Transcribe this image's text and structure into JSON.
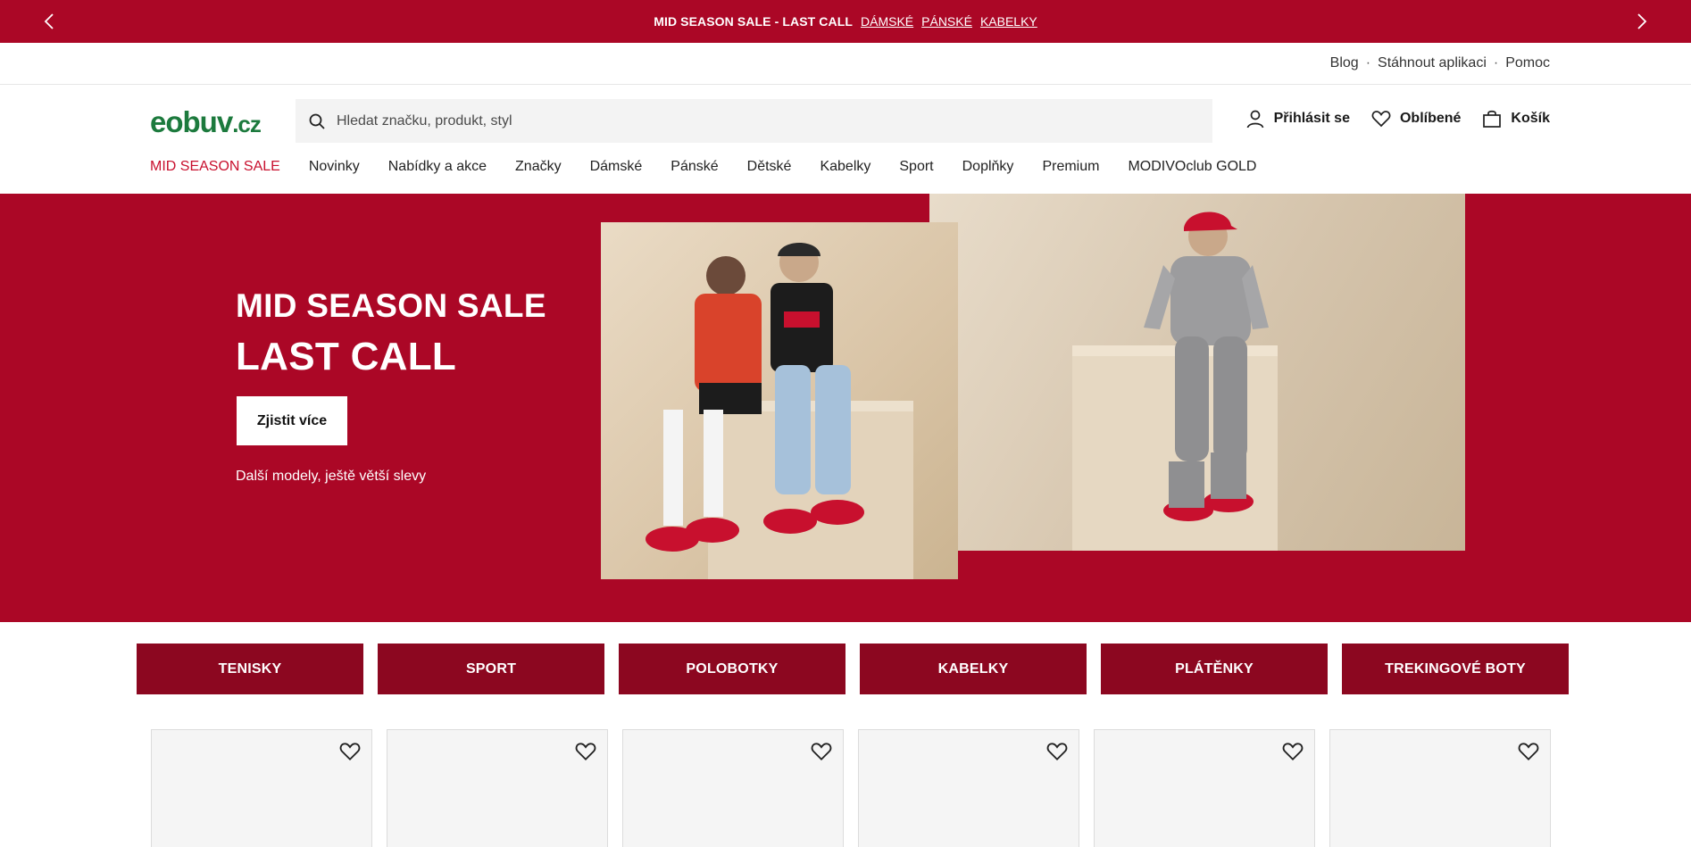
{
  "promo": {
    "text": "MID SEASON SALE - LAST CALL",
    "links": [
      "DÁMSKÉ",
      "PÁNSKÉ",
      "KABELKY"
    ]
  },
  "utility": {
    "links": [
      "Blog",
      "Stáhnout aplikaci",
      "Pomoc"
    ],
    "separator": "·"
  },
  "logo": {
    "main": "eobuv",
    "suffix": ".cz"
  },
  "search": {
    "placeholder": "Hledat značku, produkt, styl"
  },
  "header_actions": {
    "login": "Přihlásit se",
    "favorites": "Oblíbené",
    "cart": "Košík"
  },
  "nav": [
    "MID SEASON SALE",
    "Novinky",
    "Nabídky a akce",
    "Značky",
    "Dámské",
    "Pánské",
    "Dětské",
    "Kabelky",
    "Sport",
    "Doplňky",
    "Premium",
    "MODIVOclub GOLD"
  ],
  "hero": {
    "title_line1": "MID SEASON SALE",
    "title_line2": "LAST CALL",
    "button": "Zjistit více",
    "subtitle": "Další modely, ještě větší slevy"
  },
  "categories": [
    "TENISKY",
    "SPORT",
    "POLOBOTKY",
    "KABELKY",
    "PLÁTĚNKY",
    "TREKINGOVÉ BOTY"
  ],
  "colors": {
    "brand_red": "#ab0726",
    "tile_red": "#8c0720",
    "sale_text": "#c8102e",
    "logo_green": "#1c7a3d"
  }
}
